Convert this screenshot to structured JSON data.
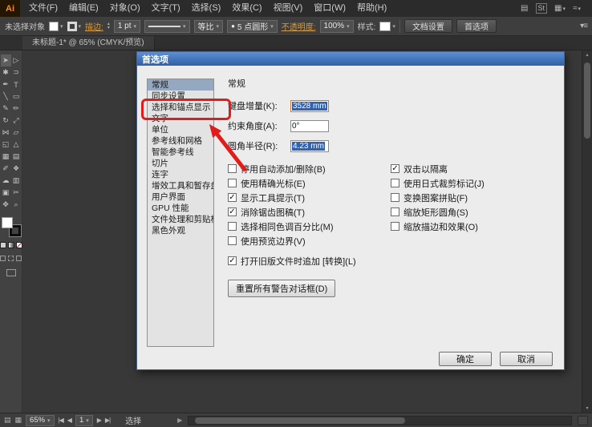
{
  "icons": {
    "caret_down": "▾",
    "caret_up": "▴",
    "check": "✓",
    "nav_first": "|◀",
    "nav_prev": "◀",
    "nav_next": "▶",
    "nav_last": "▶|",
    "panel_menu": "▾≡",
    "bullet": "●",
    "mini_play": "▶",
    "doc": "▤",
    "grid": "▦",
    "wave": "≈",
    "stock": "St"
  },
  "menubar": {
    "logo": "Ai",
    "items": [
      "文件(F)",
      "编辑(E)",
      "对象(O)",
      "文字(T)",
      "选择(S)",
      "效果(C)",
      "视图(V)",
      "窗口(W)",
      "帮助(H)"
    ]
  },
  "controlbar": {
    "selection_status": "未选择对象",
    "stroke_link": "描边:",
    "stroke_weight": "1 pt",
    "profile": "等比",
    "brush": "5 点圆形",
    "opacity_link": "不透明度:",
    "opacity": "100%",
    "style_label": "样式:",
    "doc_setup_button": "文档设置",
    "preferences_button": "首选项"
  },
  "document": {
    "tab_title": "未标题-1* @ 65% (CMYK/预览)"
  },
  "toolbar": {
    "tools": [
      {
        "name": "selection-tool",
        "glyph": "➤"
      },
      {
        "name": "direct-selection-tool",
        "glyph": "▷"
      },
      {
        "name": "magic-wand-tool",
        "glyph": "✱"
      },
      {
        "name": "lasso-tool",
        "glyph": "⊃"
      },
      {
        "name": "pen-tool",
        "glyph": "✒"
      },
      {
        "name": "type-tool",
        "glyph": "T"
      },
      {
        "name": "line-segment-tool",
        "glyph": "╲"
      },
      {
        "name": "rectangle-tool",
        "glyph": "▭"
      },
      {
        "name": "paintbrush-tool",
        "glyph": "✎"
      },
      {
        "name": "pencil-tool",
        "glyph": "✏"
      },
      {
        "name": "rotate-tool",
        "glyph": "↻"
      },
      {
        "name": "scale-tool",
        "glyph": "⤢"
      },
      {
        "name": "width-tool",
        "glyph": "⋈"
      },
      {
        "name": "free-transform-tool",
        "glyph": "▱"
      },
      {
        "name": "shape-builder-tool",
        "glyph": "◱"
      },
      {
        "name": "perspective-grid-tool",
        "glyph": "△"
      },
      {
        "name": "mesh-tool",
        "glyph": "▦"
      },
      {
        "name": "gradient-tool",
        "glyph": "▤"
      },
      {
        "name": "eyedropper-tool",
        "glyph": "✐"
      },
      {
        "name": "blend-tool",
        "glyph": "❖"
      },
      {
        "name": "symbol-sprayer-tool",
        "glyph": "☁"
      },
      {
        "name": "column-graph-tool",
        "glyph": "▥"
      },
      {
        "name": "artboard-tool",
        "glyph": "▣"
      },
      {
        "name": "slice-tool",
        "glyph": "✂"
      },
      {
        "name": "hand-tool",
        "glyph": "✥"
      },
      {
        "name": "zoom-tool",
        "glyph": "⌕"
      }
    ]
  },
  "dialog": {
    "title": "首选项",
    "categories": [
      "常规",
      "同步设置",
      "选择和锚点显示",
      "文字",
      "单位",
      "参考线和网格",
      "智能参考线",
      "切片",
      "连字",
      "增效工具和暂存盘",
      "用户界面",
      "GPU 性能",
      "文件处理和剪贴板",
      "黑色外观"
    ],
    "selected_category": "常规",
    "section_title": "常规",
    "fields": [
      {
        "label": "键盘增量(K):",
        "value": "3528 mm"
      },
      {
        "label": "约束角度(A):",
        "value": "0°"
      },
      {
        "label": "圆角半径(R):",
        "value": "4.23 mm"
      }
    ],
    "checkboxes_left": [
      {
        "label": "停用自动添加/删除(B)",
        "mark": ""
      },
      {
        "label": "使用精确光标(E)",
        "mark": ""
      },
      {
        "label": "显示工具提示(T)",
        "mark": "✓"
      },
      {
        "label": "消除锯齿图稿(T)",
        "mark": "✓"
      },
      {
        "label": "选择相同色调百分比(M)",
        "mark": ""
      },
      {
        "label": "使用预览边界(V)",
        "mark": ""
      },
      {
        "label": "打开旧版文件时追加 [转换](L)",
        "mark": "✓"
      }
    ],
    "checkboxes_right": [
      {
        "label": "双击以隔离",
        "mark": "✓"
      },
      {
        "label": "使用日式裁剪标记(J)",
        "mark": ""
      },
      {
        "label": "变换图案拼贴(F)",
        "mark": ""
      },
      {
        "label": "缩放矩形圆角(S)",
        "mark": ""
      },
      {
        "label": "缩放描边和效果(O)",
        "mark": ""
      }
    ],
    "reset_button": "重置所有警告对话框(D)",
    "ok_button": "确定",
    "cancel_button": "取消"
  },
  "annotation": {
    "color": "#e21b1b",
    "target": "选择和锚点显示"
  },
  "statusbar": {
    "zoom": "65%",
    "artboard": "1",
    "status": "选择"
  }
}
